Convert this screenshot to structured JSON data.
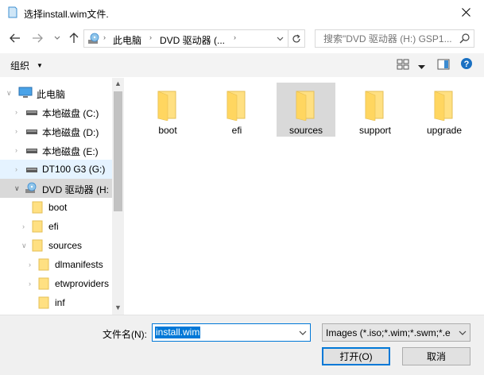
{
  "window": {
    "title": "选择install.wim文件."
  },
  "address": {
    "segments": [
      "此电脑",
      "DVD 驱动器 (..."
    ]
  },
  "search": {
    "placeholder": "搜索\"DVD 驱动器 (H:) GSP1..."
  },
  "toolbar": {
    "organize_label": "组织"
  },
  "nav_tree": [
    {
      "label": "此电脑",
      "icon": "computer-icon",
      "state": "normal"
    },
    {
      "label": "本地磁盘 (C:)",
      "icon": "drive-icon",
      "state": "normal"
    },
    {
      "label": "本地磁盘 (D:)",
      "icon": "drive-icon",
      "state": "normal"
    },
    {
      "label": "本地磁盘 (E:)",
      "icon": "drive-icon",
      "state": "normal"
    },
    {
      "label": "DT100 G3 (G:)",
      "icon": "usb-drive-icon",
      "state": "hover"
    },
    {
      "label": "DVD 驱动器 (H:",
      "icon": "dvd-drive-icon",
      "state": "selected"
    },
    {
      "label": "boot",
      "icon": "folder-icon",
      "state": "normal"
    },
    {
      "label": "efi",
      "icon": "folder-icon",
      "state": "normal"
    },
    {
      "label": "sources",
      "icon": "folder-icon",
      "state": "normal"
    },
    {
      "label": "dlmanifests",
      "icon": "folder-icon",
      "state": "normal"
    },
    {
      "label": "etwproviders",
      "icon": "folder-icon",
      "state": "normal"
    },
    {
      "label": "inf",
      "icon": "folder-icon",
      "state": "normal"
    }
  ],
  "files": [
    {
      "name": "boot",
      "selected": false
    },
    {
      "name": "efi",
      "selected": false
    },
    {
      "name": "sources",
      "selected": true
    },
    {
      "name": "support",
      "selected": false
    },
    {
      "name": "upgrade",
      "selected": false
    }
  ],
  "bottom": {
    "filename_label": "文件名(N):",
    "filename_value": "install.wim",
    "filter_value": "Images (*.iso;*.wim;*.swm;*.e",
    "open_label": "打开(O)",
    "cancel_label": "取消"
  },
  "colors": {
    "accent": "#0078d7",
    "folder": "#ffe082",
    "selection": "#d9d9d9",
    "hover": "#e5f3ff"
  }
}
